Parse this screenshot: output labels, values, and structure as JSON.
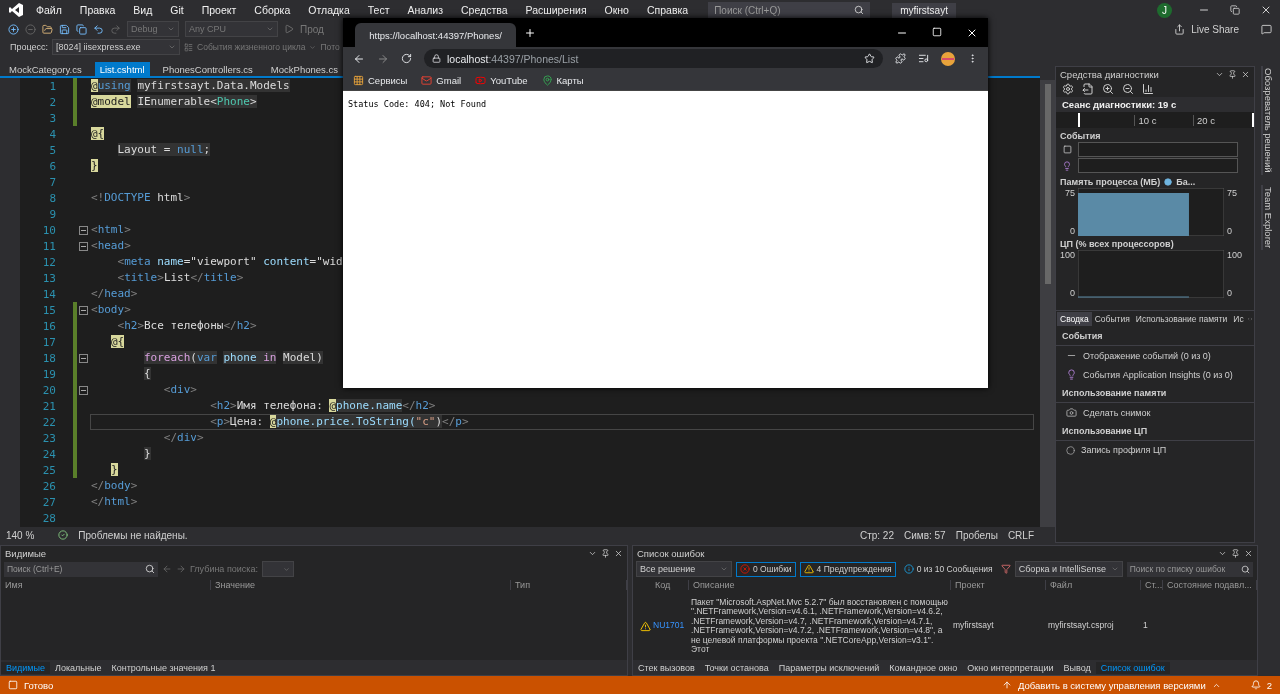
{
  "menu": {
    "items": [
      "Файл",
      "Правка",
      "Вид",
      "Git",
      "Проект",
      "Сборка",
      "Отладка",
      "Тест",
      "Анализ",
      "Средства",
      "Расширения",
      "Окно",
      "Справка"
    ],
    "search_placeholder": "Поиск (Ctrl+Q)",
    "solution_name": "myfirstsayt",
    "user_initial": "J"
  },
  "toolbar": {
    "configuration": "Debug",
    "platform": "Any CPU",
    "run_label": "Прод",
    "process_label": "Процесс:",
    "process": "[8024] iisexpress.exe",
    "lifecycle": "События жизненного цикла",
    "thread": "Пото",
    "live_share": "Live Share"
  },
  "editor": {
    "tabs": [
      {
        "label": "MockCategory.cs",
        "selected": false
      },
      {
        "label": "List.cshtml",
        "selected": true
      },
      {
        "label": "PhonesControllers.cs",
        "selected": false
      },
      {
        "label": "MockPhones.cs",
        "selected": false
      }
    ],
    "lines": [
      {
        "number": "1",
        "changed": true,
        "fold": false,
        "current": false,
        "tokens": [
          {
            "text": "@",
            "kind": "razor"
          },
          {
            "text": "using",
            "kind": "cskey"
          },
          {
            "text": " myfirstsayt.Data.Models",
            "kind": "cs"
          }
        ]
      },
      {
        "number": "2",
        "changed": true,
        "fold": false,
        "current": false,
        "tokens": [
          {
            "text": "@model",
            "kind": "razor"
          },
          {
            "text": " IEnumerable<",
            "kind": "cs"
          },
          {
            "text": "Phone",
            "kind": "cstype"
          },
          {
            "text": ">",
            "kind": "cs"
          }
        ]
      },
      {
        "number": "3",
        "changed": true,
        "fold": false,
        "current": false
      },
      {
        "number": "4",
        "changed": false,
        "fold": false,
        "current": false,
        "tokens": [
          {
            "text": "@{",
            "kind": "razor"
          }
        ]
      },
      {
        "number": "5",
        "changed": false,
        "fold": false,
        "current": false,
        "tokens": [
          {
            "text": "    Layout = ",
            "kind": "cs"
          },
          {
            "text": "null",
            "kind": "cskey"
          },
          {
            "text": ";",
            "kind": "cs"
          }
        ]
      },
      {
        "number": "6",
        "changed": false,
        "fold": false,
        "current": false,
        "tokens": [
          {
            "text": "}",
            "kind": "razor"
          }
        ]
      },
      {
        "number": "7",
        "changed": false,
        "fold": false,
        "current": false
      },
      {
        "number": "8",
        "changed": false,
        "fold": false,
        "current": false,
        "tokens": [
          {
            "text": "<!",
            "kind": "bracket"
          },
          {
            "text": "DOCTYPE",
            "kind": "tag"
          },
          {
            "text": " html",
            "kind": "text"
          },
          {
            "text": ">",
            "kind": "bracket"
          }
        ]
      },
      {
        "number": "9",
        "changed": false,
        "fold": false,
        "current": false
      },
      {
        "number": "10",
        "changed": false,
        "fold": true,
        "current": false,
        "tokens": [
          {
            "text": "<",
            "kind": "bracket"
          },
          {
            "text": "html",
            "kind": "tag"
          },
          {
            "text": ">",
            "kind": "bracket"
          }
        ]
      },
      {
        "number": "11",
        "changed": false,
        "fold": true,
        "current": false,
        "tokens": [
          {
            "text": "<",
            "kind": "bracket"
          },
          {
            "text": "head",
            "kind": "tag"
          },
          {
            "text": ">",
            "kind": "bracket"
          }
        ]
      },
      {
        "number": "12",
        "changed": false,
        "fold": false,
        "current": false,
        "tokens": [
          {
            "text": "    <",
            "kind": "bracket"
          },
          {
            "text": "meta",
            "kind": "tag"
          },
          {
            "text": " name",
            "kind": "attr"
          },
          {
            "text": "=\"viewport\"",
            "kind": "text"
          },
          {
            "text": " content",
            "kind": "attr"
          },
          {
            "text": "=\"wid",
            "kind": "text"
          }
        ]
      },
      {
        "number": "13",
        "changed": false,
        "fold": false,
        "current": false,
        "tokens": [
          {
            "text": "    <",
            "kind": "bracket"
          },
          {
            "text": "title",
            "kind": "tag"
          },
          {
            "text": ">",
            "kind": "bracket"
          },
          {
            "text": "List",
            "kind": "text"
          },
          {
            "text": "</",
            "kind": "bracket"
          },
          {
            "text": "title",
            "kind": "tag"
          },
          {
            "text": ">",
            "kind": "bracket"
          }
        ]
      },
      {
        "number": "14",
        "changed": false,
        "fold": false,
        "current": false,
        "tokens": [
          {
            "text": "</",
            "kind": "bracket"
          },
          {
            "text": "head",
            "kind": "tag"
          },
          {
            "text": ">",
            "kind": "bracket"
          }
        ]
      },
      {
        "number": "15",
        "changed": true,
        "fold": true,
        "current": false,
        "tokens": [
          {
            "text": "<",
            "kind": "bracket"
          },
          {
            "text": "body",
            "kind": "tag"
          },
          {
            "text": ">",
            "kind": "bracket"
          }
        ]
      },
      {
        "number": "16",
        "changed": true,
        "fold": false,
        "current": false,
        "tokens": [
          {
            "text": "    <",
            "kind": "bracket"
          },
          {
            "text": "h2",
            "kind": "tag"
          },
          {
            "text": ">",
            "kind": "bracket"
          },
          {
            "text": "Все телефоны",
            "kind": "text"
          },
          {
            "text": "</",
            "kind": "bracket"
          },
          {
            "text": "h2",
            "kind": "tag"
          },
          {
            "text": ">",
            "kind": "bracket"
          }
        ]
      },
      {
        "number": "17",
        "changed": true,
        "fold": false,
        "current": false,
        "tokens": [
          {
            "text": "   @{",
            "kind": "razor"
          }
        ]
      },
      {
        "number": "18",
        "changed": true,
        "fold": true,
        "current": false,
        "tokens": [
          {
            "text": "        foreach",
            "kind": "cscontrol"
          },
          {
            "text": "(",
            "kind": "cs"
          },
          {
            "text": "var",
            "kind": "cskey"
          },
          {
            "text": " phone ",
            "kind": "csvar"
          },
          {
            "text": "in",
            "kind": "cscontrol"
          },
          {
            "text": " Model)",
            "kind": "cs"
          }
        ]
      },
      {
        "number": "19",
        "changed": true,
        "fold": false,
        "current": false,
        "tokens": [
          {
            "text": "        {",
            "kind": "cs"
          }
        ]
      },
      {
        "number": "20",
        "changed": true,
        "fold": true,
        "current": false,
        "tokens": [
          {
            "text": "           <",
            "kind": "bracket"
          },
          {
            "text": "div",
            "kind": "tag"
          },
          {
            "text": ">",
            "kind": "bracket"
          }
        ]
      },
      {
        "number": "21",
        "changed": true,
        "fold": false,
        "current": false,
        "tokens": [
          {
            "text": "                  <",
            "kind": "bracket"
          },
          {
            "text": "h2",
            "kind": "tag"
          },
          {
            "text": ">",
            "kind": "bracket"
          },
          {
            "text": "Имя телефона: ",
            "kind": "text"
          },
          {
            "text": "@",
            "kind": "razor"
          },
          {
            "text": "phone.name",
            "kind": "csvar"
          },
          {
            "text": "</",
            "kind": "bracket"
          },
          {
            "text": "h2",
            "kind": "tag"
          },
          {
            "text": ">",
            "kind": "bracket"
          }
        ]
      },
      {
        "number": "22",
        "changed": true,
        "fold": false,
        "current": true,
        "tokens": [
          {
            "text": "                  <",
            "kind": "bracket"
          },
          {
            "text": "p",
            "kind": "tag"
          },
          {
            "text": ">",
            "kind": "bracket"
          },
          {
            "text": "Цена: ",
            "kind": "text"
          },
          {
            "text": "@",
            "kind": "razor"
          },
          {
            "text": "phone.price.ToString(",
            "kind": "csvar"
          },
          {
            "text": "\"c\"",
            "kind": "csstring"
          },
          {
            "text": ")",
            "kind": "cs"
          },
          {
            "text": "</",
            "kind": "bracket"
          },
          {
            "text": "p",
            "kind": "tag"
          },
          {
            "text": ">",
            "kind": "bracket"
          }
        ]
      },
      {
        "number": "23",
        "changed": true,
        "fold": false,
        "current": false,
        "tokens": [
          {
            "text": "           </",
            "kind": "bracket"
          },
          {
            "text": "div",
            "kind": "tag"
          },
          {
            "text": ">",
            "kind": "bracket"
          }
        ]
      },
      {
        "number": "24",
        "changed": true,
        "fold": false,
        "current": false,
        "tokens": [
          {
            "text": "        }",
            "kind": "cs"
          }
        ]
      },
      {
        "number": "25",
        "changed": true,
        "fold": false,
        "current": false,
        "tokens": [
          {
            "text": "   }",
            "kind": "razor"
          }
        ]
      },
      {
        "number": "26",
        "changed": false,
        "fold": false,
        "current": false,
        "tokens": [
          {
            "text": "</",
            "kind": "bracket"
          },
          {
            "text": "body",
            "kind": "tag"
          },
          {
            "text": ">",
            "kind": "bracket"
          }
        ]
      },
      {
        "number": "27",
        "changed": false,
        "fold": false,
        "current": false,
        "tokens": [
          {
            "text": "</",
            "kind": "bracket"
          },
          {
            "text": "html",
            "kind": "tag"
          },
          {
            "text": ">",
            "kind": "bracket"
          }
        ]
      },
      {
        "number": "28",
        "changed": false,
        "fold": false,
        "current": false
      }
    ],
    "zoom": "140 %",
    "issues": "Проблемы не найдены.",
    "line_pos": "Стр: 22",
    "col_pos": "Симв: 57",
    "indent": "Пробелы",
    "eol": "CRLF"
  },
  "browser": {
    "tab_title": "https://localhost:44397/Phones/",
    "url_host": "localhost",
    "url_rest": ":44397/Phones/List",
    "bookmarks": [
      {
        "label": "Сервисы",
        "kind": "apps"
      },
      {
        "label": "Gmail",
        "kind": "mail"
      },
      {
        "label": "YouTube",
        "kind": "video"
      },
      {
        "label": "Карты",
        "kind": "maps"
      }
    ],
    "content": "Status Code: 404; Not Found"
  },
  "diagnostics": {
    "title": "Средства диагностики",
    "session": "Сеанс диагностики: 19 с",
    "ticks": [
      "10 с",
      "20 с"
    ],
    "events_title": "События",
    "memory_title": "Память процесса (МБ)",
    "memory_legend": "Ба...",
    "memory_axis": [
      "75",
      "0",
      "75",
      "0"
    ],
    "cpu_title": "ЦП (% всех процессоров)",
    "cpu_axis": [
      "100",
      "0",
      "100",
      "0"
    ],
    "tabs": [
      {
        "label": "Сводка",
        "selected": true
      },
      {
        "label": "События",
        "selected": false
      },
      {
        "label": "Использование памяти",
        "selected": false
      },
      {
        "label": "Ис",
        "selected": false
      }
    ],
    "sections": [
      {
        "title": "События",
        "items": [
          {
            "label": "Отображение событий (0 из 0)",
            "kind": "events"
          },
          {
            "label": "События Application Insights (0 из 0)",
            "kind": "insights"
          }
        ]
      },
      {
        "title": "Использование памяти",
        "items": [
          {
            "label": "Сделать снимок",
            "kind": "snapshot"
          }
        ]
      },
      {
        "title": "Использование ЦП",
        "items": [
          {
            "label": "Запись профиля ЦП",
            "kind": "record"
          }
        ]
      }
    ]
  },
  "side_tabs": [
    "Обозреватель решений",
    "Team Explorer"
  ],
  "watch": {
    "title": "Видимые",
    "search_placeholder": "Поиск (Ctrl+E)",
    "depth_label": "Глубина поиска:",
    "columns": [
      "Имя",
      "Значение",
      "Тип"
    ],
    "tabs": [
      {
        "label": "Видимые",
        "selected": true
      },
      {
        "label": "Локальные",
        "selected": false
      },
      {
        "label": "Контрольные значения 1",
        "selected": false
      }
    ]
  },
  "error_list": {
    "title": "Список ошибок",
    "scope": "Все решение",
    "errors": "0 Ошибки",
    "warnings": "4 Предупреждения",
    "messages": "0 из 10 Сообщения",
    "source": "Сборка и IntelliSense",
    "search_placeholder": "Поиск по списку ошибок",
    "columns": [
      "Код",
      "Описание",
      "Проект",
      "Файл",
      "Ст...",
      "Состояние подавл..."
    ],
    "rows": [
      {
        "code": "NU1701",
        "description": "Пакет \"Microsoft.AspNet.Mvc 5.2.7\" был восстановлен с помощью \".NETFramework,Version=v4.6.1, .NETFramework,Version=v4.6.2, .NETFramework,Version=v4.7, .NETFramework,Version=v4.7.1, .NETFramework,Version=v4.7.2, .NETFramework,Version=v4.8\", а не целевой платформы проекта \".NETCoreApp,Version=v3.1\". Этот",
        "project": "myfirstsayt",
        "file": "myfirstsayt.csproj",
        "line": "1"
      }
    ]
  },
  "bottom_tabs": [
    {
      "label": "Стек вызовов",
      "selected": false
    },
    {
      "label": "Точки останова",
      "selected": false
    },
    {
      "label": "Параметры исключений",
      "selected": false
    },
    {
      "label": "Командное окно",
      "selected": false
    },
    {
      "label": "Окно интерпретации",
      "selected": false
    },
    {
      "label": "Вывод",
      "selected": false
    },
    {
      "label": "Список ошибок",
      "selected": true
    }
  ],
  "status_bar": {
    "text": "Готово",
    "source_control": "Добавить в систему управления версиями",
    "notifications": "2"
  }
}
